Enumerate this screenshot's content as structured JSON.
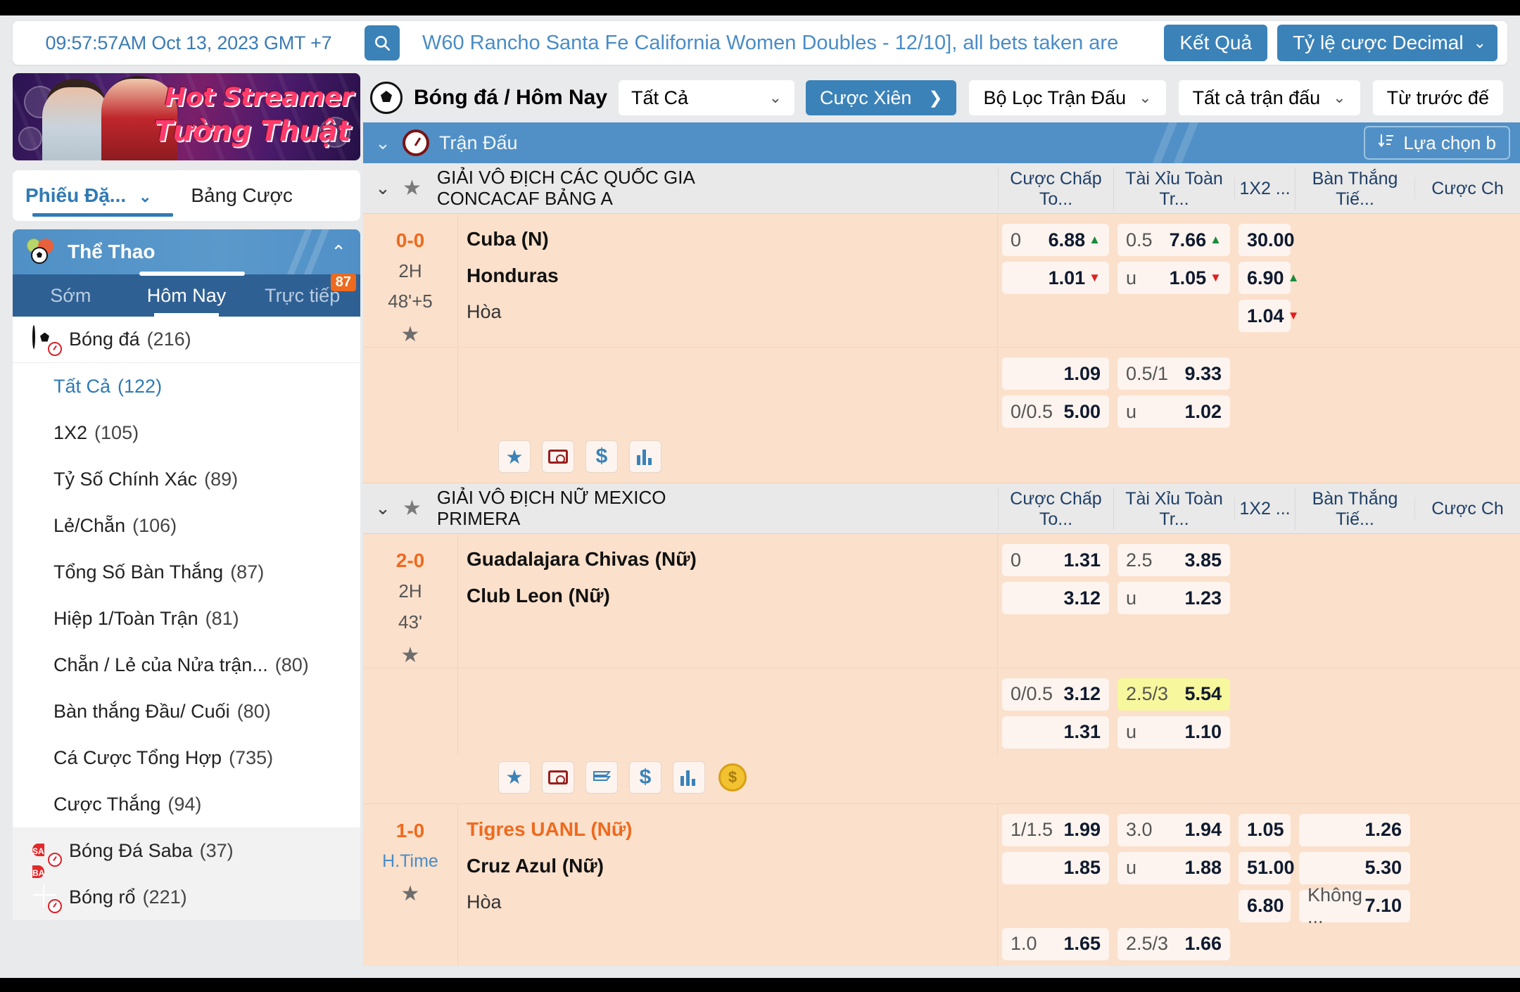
{
  "header": {
    "clock": "09:57:57AM Oct 13, 2023 GMT +7",
    "search_icon": "search-icon",
    "marquee": "W60 Rancho Santa Fe California Women Doubles - 12/10], all bets taken are",
    "results_button": "Kết Quả",
    "odds_format": "Tỷ lệ cược Decimal",
    "odds_chevron": "⌄"
  },
  "sidebar": {
    "promo": {
      "line1": "Hot Streamer",
      "line2": "Tường Thuật"
    },
    "tabs": {
      "primary": "Phiếu Đặ...",
      "primary_chevron": "⌄",
      "secondary": "Bảng Cược"
    },
    "sports_header": {
      "label": "Thể Thao",
      "caret": "⌃",
      "icon": "multi-ball-icon"
    },
    "subtabs": [
      {
        "label": "Sớm",
        "active": false,
        "badge": ""
      },
      {
        "label": "Hôm Nay",
        "active": true,
        "badge": ""
      },
      {
        "label": "Trực tiếp",
        "active": false,
        "badge": "87"
      }
    ],
    "sport_main": {
      "label": "Bóng đá",
      "count": "(216)",
      "icon": "soccer-live-icon"
    },
    "markets": [
      {
        "label": "Tất Cả",
        "count": "(122)",
        "active": true
      },
      {
        "label": "1X2",
        "count": "(105)",
        "active": false
      },
      {
        "label": "Tỷ Số Chính Xác",
        "count": "(89)",
        "active": false
      },
      {
        "label": "Lẻ/Chẵn",
        "count": "(106)",
        "active": false
      },
      {
        "label": "Tổng Số Bàn Thắng",
        "count": "(87)",
        "active": false
      },
      {
        "label": "Hiệp 1/Toàn Trận",
        "count": "(81)",
        "active": false
      },
      {
        "label": "Chẵn / Lẻ của Nửa trận...",
        "count": "(80)",
        "active": false
      },
      {
        "label": "Bàn thắng Đầu/ Cuối",
        "count": "(80)",
        "active": false
      },
      {
        "label": "Cá Cược Tổng Hợp",
        "count": "(735)",
        "active": false
      },
      {
        "label": "Cược Thắng",
        "count": "(94)",
        "active": false
      }
    ],
    "other_sports": [
      {
        "label": "Bóng Đá Saba",
        "count": "(37)",
        "icon": "saba-live-icon"
      },
      {
        "label": "Bóng rổ",
        "count": "(221)",
        "icon": "basketball-live-icon"
      }
    ]
  },
  "navbar": {
    "soccer_icon": "soccer-ball-icon",
    "title": "Bóng đá / Hôm Nay",
    "all_select": "Tất Cả",
    "all_chevron": "⌄",
    "parlay_button": "Cược Xiên",
    "parlay_arrow": "❯",
    "filters": [
      {
        "label": "Bộ Lọc Trận Đấu",
        "chevron": "⌄"
      },
      {
        "label": "Tất cả trận đấu",
        "chevron": "⌄"
      },
      {
        "label": "Từ trước đế",
        "chevron": ""
      }
    ]
  },
  "bluebar": {
    "collapse_chevron": "⌄",
    "clock_icon": "stopwatch-icon",
    "label": "Trận Đấu",
    "select_bet_button": "Lựa chọn b",
    "select_bet_icon": "sort-icon"
  },
  "columns": [
    {
      "label": "Cược Chấp To...",
      "key": "handicap"
    },
    {
      "label": "Tài Xỉu Toàn Tr...",
      "key": "overunder"
    },
    {
      "label": "1X2 ...",
      "key": "x12"
    },
    {
      "label": "Bàn Thắng Tiế...",
      "key": "nextgoal"
    },
    {
      "label": "Cược Ch",
      "key": "morebets"
    }
  ],
  "leagues": [
    {
      "name": "GIẢI VÔ ĐỊCH CÁC QUỐC GIA CONCACAF BẢNG A",
      "chevron": "⌄",
      "star_icon": "star-icon",
      "matches": [
        {
          "score": "0-0",
          "period": "2H",
          "minute": "48'+5",
          "star_icon": "star-icon",
          "home": "Cuba (N)",
          "away": "Honduras",
          "draw": "Hòa",
          "home_orange": false,
          "odds_main": {
            "handicap": [
              {
                "hcap": "0",
                "val": "6.88",
                "trend": "up"
              },
              {
                "hcap": "",
                "val": "1.01",
                "trend": "down"
              }
            ],
            "overunder": [
              {
                "hcap": "0.5",
                "val": "7.66",
                "trend": "up"
              },
              {
                "hcap": "u",
                "val": "1.05",
                "trend": "down"
              }
            ],
            "x12": [
              {
                "hcap": "",
                "val": "30.00",
                "trend": ""
              },
              {
                "hcap": "",
                "val": "6.90",
                "trend": "up"
              },
              {
                "hcap": "",
                "val": "1.04",
                "trend": "down"
              }
            ],
            "nextgoal": [],
            "morebets": []
          },
          "odds_secondary": {
            "handicap": [
              {
                "hcap": "",
                "val": "1.09",
                "trend": ""
              },
              {
                "hcap": "0/0.5",
                "val": "5.00",
                "trend": ""
              }
            ],
            "overunder": [
              {
                "hcap": "0.5/1",
                "val": "9.33",
                "trend": ""
              },
              {
                "hcap": "u",
                "val": "1.02",
                "trend": ""
              }
            ],
            "x12": [],
            "nextgoal": [],
            "morebets": []
          },
          "action_icons": [
            "star-icon",
            "pitch-icon",
            "dollar-icon",
            "stats-icon"
          ]
        }
      ]
    },
    {
      "name": "GIẢI VÔ ĐỊCH NỮ MEXICO PRIMERA",
      "chevron": "⌄",
      "star_icon": "star-icon",
      "matches": [
        {
          "score": "2-0",
          "period": "2H",
          "minute": "43'",
          "star_icon": "star-icon",
          "home": "Guadalajara Chivas (Nữ)",
          "away": "Club Leon (Nữ)",
          "draw": "",
          "home_orange": false,
          "odds_main": {
            "handicap": [
              {
                "hcap": "0",
                "val": "1.31",
                "trend": ""
              },
              {
                "hcap": "",
                "val": "3.12",
                "trend": ""
              }
            ],
            "overunder": [
              {
                "hcap": "2.5",
                "val": "3.85",
                "trend": ""
              },
              {
                "hcap": "u",
                "val": "1.23",
                "trend": ""
              }
            ],
            "x12": [],
            "nextgoal": [],
            "morebets": []
          },
          "odds_secondary": {
            "handicap": [
              {
                "hcap": "0/0.5",
                "val": "3.12",
                "trend": ""
              },
              {
                "hcap": "",
                "val": "1.31",
                "trend": ""
              }
            ],
            "overunder": [
              {
                "hcap": "2.5/3",
                "val": "5.54",
                "trend": "",
                "highlight": true
              },
              {
                "hcap": "u",
                "val": "1.10",
                "trend": ""
              }
            ],
            "x12": [],
            "nextgoal": [],
            "morebets": []
          },
          "action_icons": [
            "star-icon",
            "pitch-icon",
            "stack-icon",
            "dollar-icon",
            "stats-icon",
            "coin-icon"
          ]
        },
        {
          "score": "1-0",
          "period": "H.Time",
          "minute": "",
          "star_icon": "star-icon",
          "home": "Tigres UANL (Nữ)",
          "away": "Cruz Azul (Nữ)",
          "draw": "Hòa",
          "home_orange": true,
          "odds_main": {
            "handicap": [
              {
                "hcap": "1/1.5",
                "val": "1.99",
                "trend": ""
              },
              {
                "hcap": "",
                "val": "1.85",
                "trend": ""
              }
            ],
            "overunder": [
              {
                "hcap": "3.0",
                "val": "1.94",
                "trend": ""
              },
              {
                "hcap": "u",
                "val": "1.88",
                "trend": ""
              }
            ],
            "x12": [
              {
                "hcap": "",
                "val": "1.05",
                "trend": ""
              },
              {
                "hcap": "",
                "val": "51.00",
                "trend": ""
              },
              {
                "hcap": "",
                "val": "6.80",
                "trend": ""
              }
            ],
            "nextgoal": [
              {
                "hcap": "",
                "val": "1.26",
                "trend": ""
              },
              {
                "hcap": "",
                "val": "5.30",
                "trend": ""
              },
              {
                "hcap": "Không ...",
                "val": "7.10",
                "trend": ""
              }
            ],
            "morebets": []
          },
          "odds_secondary": {
            "handicap": [
              {
                "hcap": "1.0",
                "val": "1.65",
                "trend": ""
              }
            ],
            "overunder": [
              {
                "hcap": "2.5/3",
                "val": "1.66",
                "trend": ""
              }
            ],
            "x12": [],
            "nextgoal": [],
            "morebets": []
          },
          "action_icons": []
        }
      ]
    }
  ],
  "colors": {
    "accent_blue": "#3b82b8",
    "row_bg": "#fbe0cb",
    "odd_bg": "#fdf4ef",
    "score_orange": "#ee6a1e",
    "highlight_yellow": "#f7f79d",
    "up_green": "#1a8a3c",
    "down_red": "#e02020"
  }
}
